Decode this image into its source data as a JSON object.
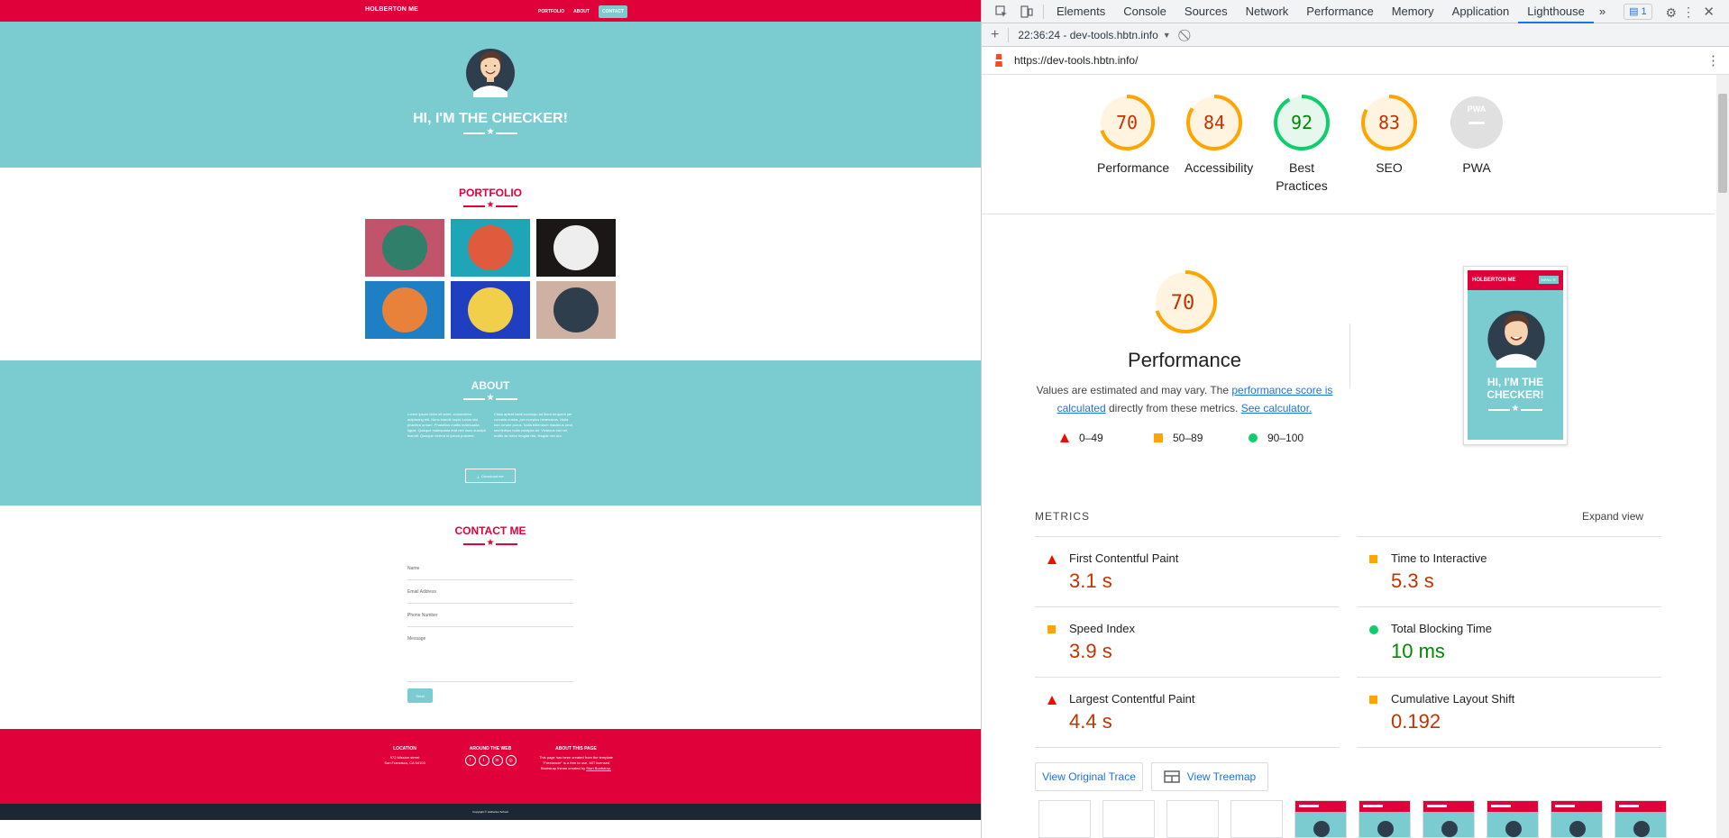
{
  "site": {
    "brand": "HOLBERTON ME",
    "nav": [
      "PORTFOLIO",
      "ABOUT",
      "CONTACT"
    ],
    "hero_title": "HI, I'M THE CHECKER!",
    "portfolio_title": "PORTFOLIO",
    "about_title": "ABOUT",
    "about_col1": "Lorem ipsum dolor sit amet, consectetur adipiscing elit. Nunc blandit turpis luctus nisi pharetra ornare. Phasellus mattis malesuada ligula. Quisque malesuada erat nec risus suscipit blandit. Quisque viverra in ipsum posuere.",
    "about_col2": "Class aptent taciti sociosqu ad litora torquent per conubia nostra, per inceptos himenaeos. Nulla non ornare purus. Nulla bibendum maximus urna, sed finibus nulla volutpat vel. Vivamus nisi vel, mollis ac tortor feugiat nisi, feugiat nec dui.",
    "download_label": "Download me",
    "contact_title": "CONTACT ME",
    "fields": [
      "Name",
      "Email Address",
      "Phone Number",
      "Message"
    ],
    "send_label": "Send",
    "footer": {
      "location_title": "LOCATION",
      "location_line1": "972 Mission street",
      "location_line2": "San Francisco, CA 94103",
      "web_title": "AROUND THE WEB",
      "social": [
        "f",
        "t",
        "in",
        "◎"
      ],
      "about_page_title": "ABOUT THIS PAGE",
      "about_page_text": "This page has been created from the template \"Freelancer\" is a free to use, MIT licensed Bootstrap theme created by",
      "about_page_link": "Start Bootstrap."
    },
    "copyright": "Copyright © Holberton School"
  },
  "devtools": {
    "tabs": [
      "Elements",
      "Console",
      "Sources",
      "Network",
      "Performance",
      "Memory",
      "Application",
      "Lighthouse"
    ],
    "active_tab": "Lighthouse",
    "more_tabs": "»",
    "issues_count": "1",
    "report_time": "22:36:24 - dev-tools.hbtn.info",
    "report_url": "https://dev-tools.hbtn.info/",
    "scores": [
      {
        "label": "Performance",
        "value": "70",
        "score": 0.7
      },
      {
        "label": "Accessibility",
        "value": "84",
        "score": 0.84
      },
      {
        "label": "Best Practices",
        "value": "92",
        "score": 0.92
      },
      {
        "label": "SEO",
        "value": "83",
        "score": 0.83
      },
      {
        "label": "PWA",
        "value": "PWA",
        "score": 0
      }
    ],
    "perf_value": "70",
    "perf_title": "Performance",
    "perf_desc_1": "Values are estimated and may vary. The ",
    "perf_link_1": "performance score is calculated",
    "perf_desc_2": " directly from these metrics. ",
    "perf_link_2": "See calculator.",
    "legend": [
      "0–49",
      "50–89",
      "90–100"
    ],
    "preview_brand": "HOLBERTON ME",
    "preview_menu": "MENU ☰",
    "preview_title": "HI, I'M THE CHECKER!",
    "metrics_heading": "METRICS",
    "expand_label": "Expand view",
    "metrics": [
      {
        "name": "First Contentful Paint",
        "value": "3.1 s",
        "rating": "fail"
      },
      {
        "name": "Time to Interactive",
        "value": "5.3 s",
        "rating": "average"
      },
      {
        "name": "Speed Index",
        "value": "3.9 s",
        "rating": "average"
      },
      {
        "name": "Total Blocking Time",
        "value": "10 ms",
        "rating": "pass"
      },
      {
        "name": "Largest Contentful Paint",
        "value": "4.4 s",
        "rating": "fail"
      },
      {
        "name": "Cumulative Layout Shift",
        "value": "0.192",
        "rating": "average"
      }
    ],
    "view_trace_label": "View Original Trace",
    "view_treemap_label": "View Treemap"
  },
  "colors": {
    "brand_red": "#e0003a",
    "teal": "#7accd0",
    "fail": "#eb0f00",
    "average": "#ffa400",
    "pass": "#0cce6b",
    "fail_text": "#c33300",
    "average_text": "#c33300",
    "pass_text": "#008800"
  }
}
